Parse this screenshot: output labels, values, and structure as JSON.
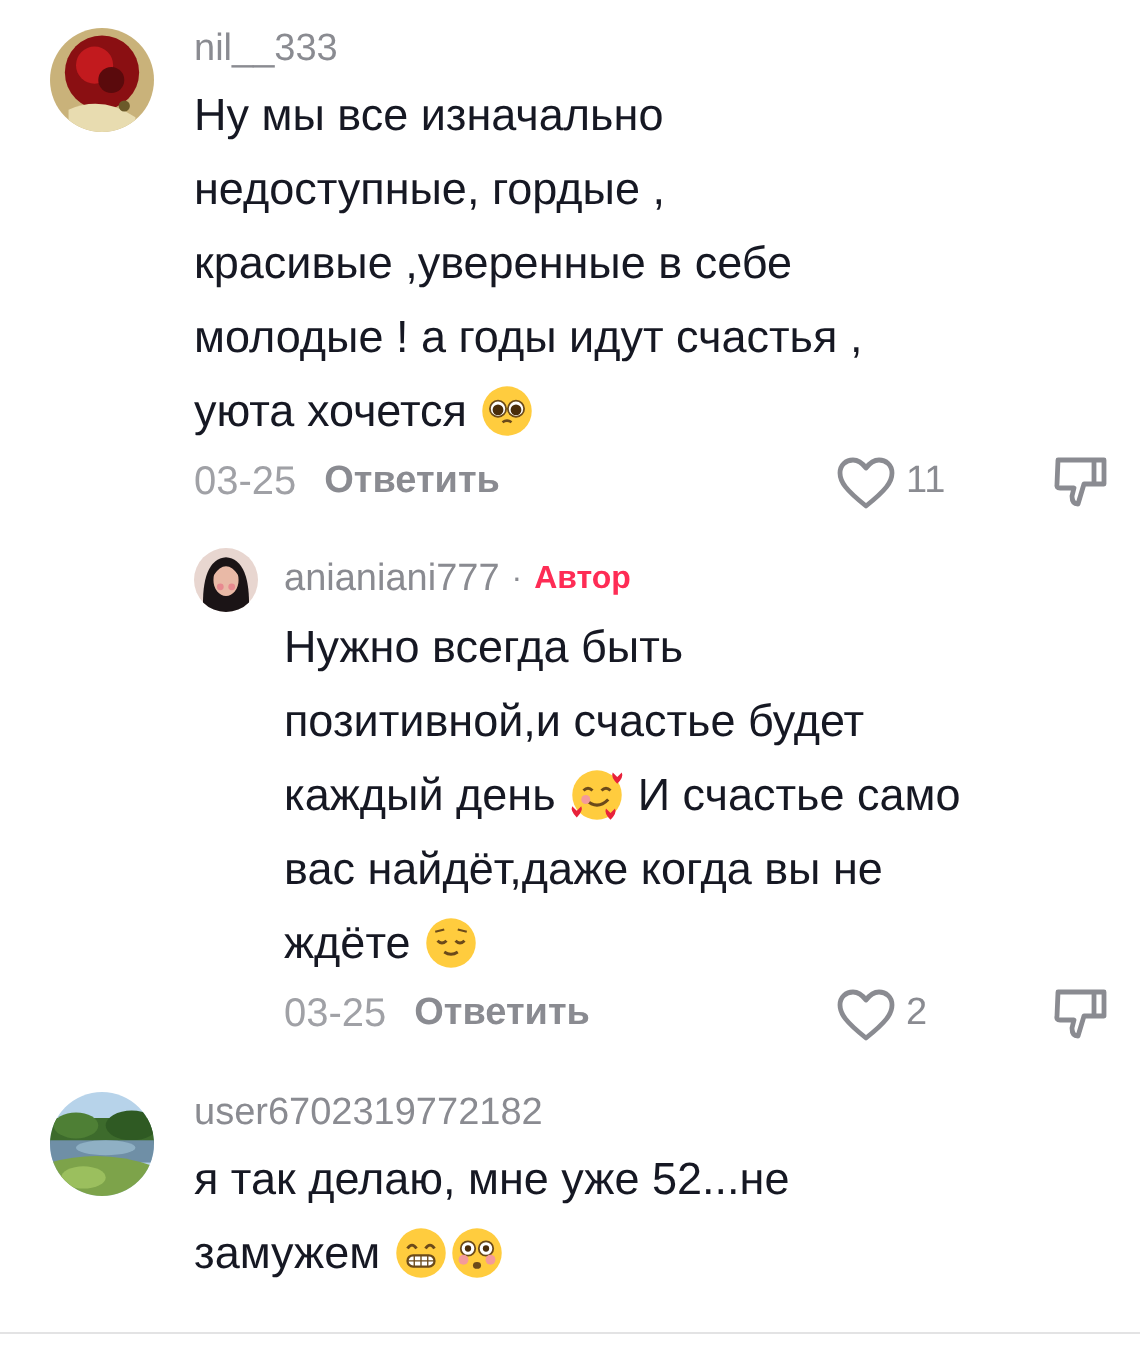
{
  "comments": [
    {
      "username": "nil__333",
      "avatar": {
        "kind": "picture"
      },
      "lines": [
        [
          {
            "kind": "text",
            "text": "Ну мы все изначально"
          }
        ],
        [
          {
            "kind": "text",
            "text": "недоступные, гордые ,"
          }
        ],
        [
          {
            "kind": "text",
            "text": "красивые ,уверенные в себе"
          }
        ],
        [
          {
            "kind": "text",
            "text": "молодые ! а годы идут счастья ,"
          }
        ],
        [
          {
            "kind": "text",
            "text": "уюта хочется"
          },
          {
            "kind": "pleading"
          }
        ]
      ],
      "date": "03-25",
      "reply_label": "Ответить",
      "likes": "11",
      "replies": [
        {
          "username": "anianiani777",
          "badge_separator": "·",
          "author_label": "Автор",
          "avatar": {
            "kind": "picture"
          },
          "lines": [
            [
              {
                "kind": "text",
                "text": "Нужно всегда быть"
              }
            ],
            [
              {
                "kind": "text",
                "text": "позитивной,и счастье будет"
              }
            ],
            [
              {
                "kind": "text",
                "text": "каждый день"
              },
              {
                "kind": "hearts"
              },
              {
                "kind": "text",
                "text": "И счастье само"
              }
            ],
            [
              {
                "kind": "text",
                "text": "вас найдёт,даже когда вы не"
              }
            ],
            [
              {
                "kind": "text",
                "text": "ждёте"
              },
              {
                "kind": "relieved"
              }
            ]
          ],
          "date": "03-25",
          "reply_label": "Ответить",
          "likes": "2"
        }
      ]
    },
    {
      "username": "user6702319772182",
      "avatar": {
        "kind": "picture"
      },
      "lines": [
        [
          {
            "kind": "text",
            "text": "я так делаю, мне уже 52...не"
          }
        ],
        [
          {
            "kind": "text",
            "text": "замужем"
          },
          {
            "kind": "grin"
          },
          {
            "kind": "flushed"
          }
        ]
      ]
    }
  ]
}
